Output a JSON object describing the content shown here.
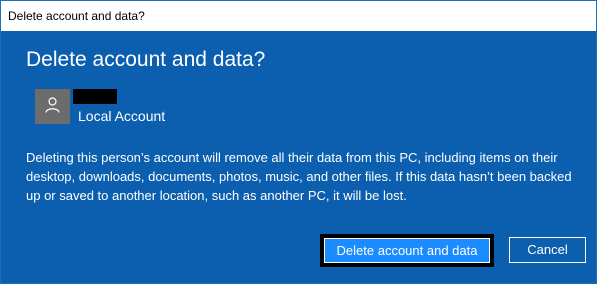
{
  "window": {
    "title": "Delete account and data?"
  },
  "dialog": {
    "heading": "Delete account and data?",
    "account": {
      "avatar_icon": "person-icon",
      "name_redacted": true,
      "type": "Local Account"
    },
    "message": "Deleting this person’s account will remove all their data from this PC, including items on their desktop, downloads, documents, photos, music, and other files. If this data hasn’t been backed up or saved to another location, such as another PC, it will be lost.",
    "buttons": {
      "delete_label": "Delete account and data",
      "cancel_label": "Cancel"
    }
  },
  "colors": {
    "dialog_background": "#0b5fae",
    "primary_button": "#1a8cff",
    "avatar_background": "#6c6c6c",
    "text": "#ffffff"
  }
}
